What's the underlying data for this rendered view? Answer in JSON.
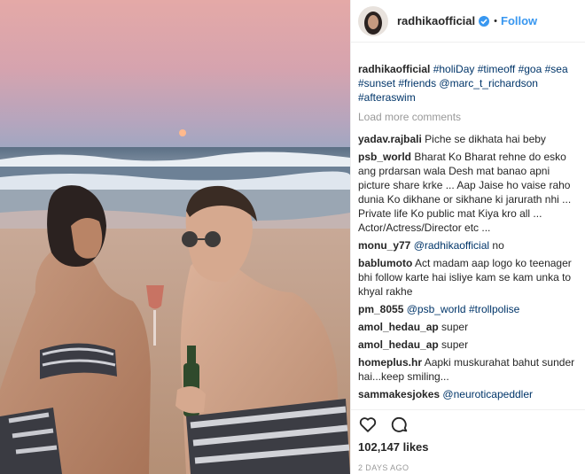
{
  "header": {
    "username": "radhikaofficial",
    "separator": "•",
    "follow_label": "Follow"
  },
  "caption": {
    "username": "radhikaofficial",
    "tags": [
      "#holiDay",
      "#timeoff",
      "#goa",
      "#sea",
      "#sunset",
      "#friends",
      "@marc_t_richardson",
      "#afteraswim"
    ]
  },
  "load_more_label": "Load more comments",
  "comments": [
    {
      "user": "yadav.rajbali",
      "text": "Piche se dikhata hai beby"
    },
    {
      "user": "psb_world",
      "text": "Bharat Ko Bharat rehne do esko ang prdarsan wala Desh mat banao apni picture share krke ... Aap Jaise ho vaise raho dunia Ko dikhane or sikhane ki jarurath nhi ... Private life Ko public mat Kiya kro all ... Actor/Actress/Director etc ..."
    },
    {
      "user": "monu_y77",
      "mention": "@radhikaofficial",
      "text": "no"
    },
    {
      "user": "bablumoto",
      "text": "Act madam aap logo ko teenager bhi follow karte hai isliye kam se kam unka to khyal rakhe"
    },
    {
      "user": "pm_8055",
      "mention": "@psb_world",
      "tag": "#trollpolise"
    },
    {
      "user": "amol_hedau_ap",
      "text": "super"
    },
    {
      "user": "amol_hedau_ap",
      "text": "super"
    },
    {
      "user": "homeplus.hr",
      "text": "Aapki muskurahat bahut sunder hai...keep smiling..."
    },
    {
      "user": "sammakesjokes",
      "mention": "@neuroticapeddler"
    }
  ],
  "likes": "102,147 likes",
  "date": "2 DAYS AGO",
  "icons": {
    "like": "heart-icon",
    "comment": "comment-icon",
    "verified": "verified-badge-icon"
  },
  "colors": {
    "link": "#003569",
    "follow": "#3897f0",
    "muted": "#999999"
  }
}
